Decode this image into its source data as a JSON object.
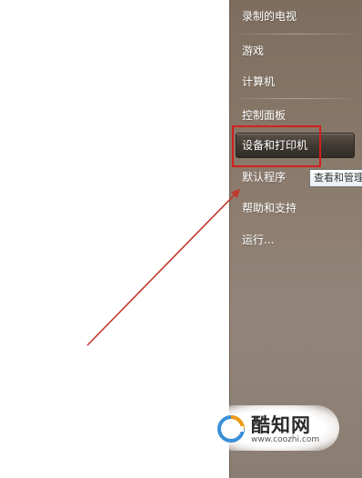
{
  "start_menu": {
    "items": [
      {
        "label": "录制的电视"
      },
      {
        "label": "游戏"
      },
      {
        "label": "计算机"
      },
      {
        "label": "控制面板"
      },
      {
        "label": "设备和打印机"
      },
      {
        "label": "默认程序"
      },
      {
        "label": "帮助和支持"
      },
      {
        "label": "运行..."
      }
    ],
    "highlighted_index": 4,
    "tooltip": "查看和管理"
  },
  "watermark": {
    "title": "酷知网",
    "url": "www.coozhi.com"
  },
  "colors": {
    "annotation_red": "#d41e1e",
    "arrow_red": "#c0392b",
    "pane_brown": "#8a7a6b"
  }
}
